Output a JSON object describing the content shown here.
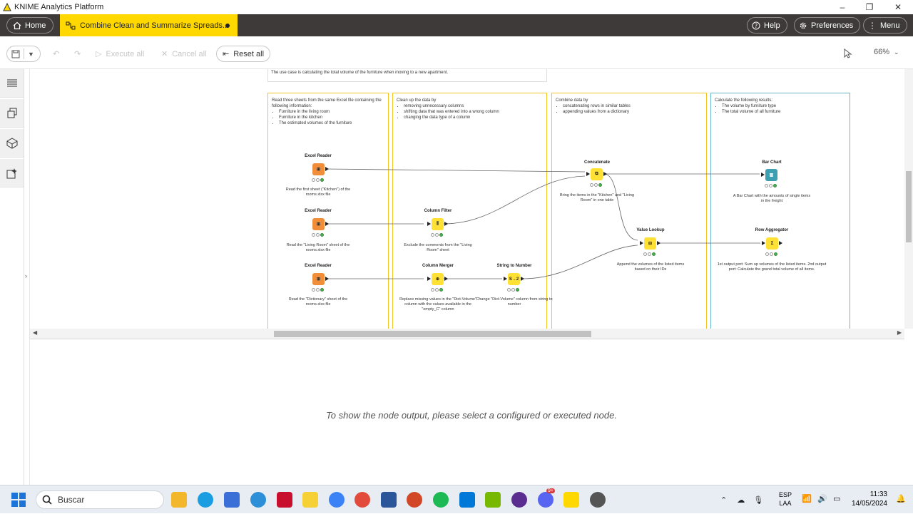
{
  "window": {
    "title": "KNIME Analytics Platform"
  },
  "appbar": {
    "home_label": "Home",
    "tab_label": "Combine Clean and Summarize Spreads...",
    "help_label": "Help",
    "preferences_label": "Preferences",
    "menu_label": "Menu"
  },
  "toolbar": {
    "execute_all_label": "Execute all",
    "cancel_all_label": "Cancel all",
    "reset_all_label": "Reset all",
    "zoom_label": "66%"
  },
  "workflow": {
    "top_annotation": "The use case is calculating the total volume of the furniture when moving to a new apartment.",
    "sections": [
      {
        "text": "Read three sheets from the same Excel file containing the following information:",
        "items": [
          "Furniture in the living room",
          "Furniture in the kitchen",
          "The estimated volumes of the furniture"
        ]
      },
      {
        "text": "Clean up the data by",
        "items": [
          "removing unnecessary columns",
          "shifting data that was entered into a wrong column",
          "changing the data type of a column"
        ]
      },
      {
        "text": "Combine data by",
        "items": [
          "concatenating rows in similar tables",
          "appending values from a dictionary"
        ]
      },
      {
        "text": "Calculate the following results:",
        "items": [
          "The volume by furniture type",
          "The total volume of all furniture"
        ]
      }
    ],
    "nodes": [
      {
        "name": "Excel Reader",
        "desc": "Read the first sheet (\"Kitchen\") of the rooms.xlsx file"
      },
      {
        "name": "Excel Reader",
        "desc": "Read the \"Living Room\" sheet of the rooms.xlsx file"
      },
      {
        "name": "Excel Reader",
        "desc": "Read the \"Dictionary\" sheet of the rooms.xlsx file"
      },
      {
        "name": "Column Filter",
        "desc": "Exclude the comments from the \"Living Room\" sheet"
      },
      {
        "name": "Column Merger",
        "desc": "Replace missing values in the \"Dict-Volume\" column with the values available in the \"empty_C\" column"
      },
      {
        "name": "String to Number",
        "desc": "Change \"Dict-Volume\" column from string to number"
      },
      {
        "name": "Concatenate",
        "desc": "Bring the items in the \"Kitchen\" and \"Living Room\" in one table"
      },
      {
        "name": "Value Lookup",
        "desc": "Append the volumes of the listed items based on their IDs"
      },
      {
        "name": "Bar Chart",
        "desc": "A Bar Chart with the amounts of single items in the freight"
      },
      {
        "name": "Row Aggregator",
        "desc": "1st output port: Sum up volumes of the listed items. 2nd output port: Calculate the grand total volume of all items."
      }
    ]
  },
  "output": {
    "message": "To show the node output, please select a configured or executed node."
  },
  "taskbar": {
    "search_placeholder": "Buscar",
    "lang_top": "ESP",
    "lang_bottom": "LAA",
    "time": "11:33",
    "date": "14/05/2024",
    "notification_badge": "9+"
  },
  "colors": {
    "knime_yellow": "#ffd800",
    "appbar_dark": "#3e3a39",
    "node_orange": "#f08e3a",
    "node_yellow": "#ffe034",
    "node_teal": "#3e9fb0"
  }
}
